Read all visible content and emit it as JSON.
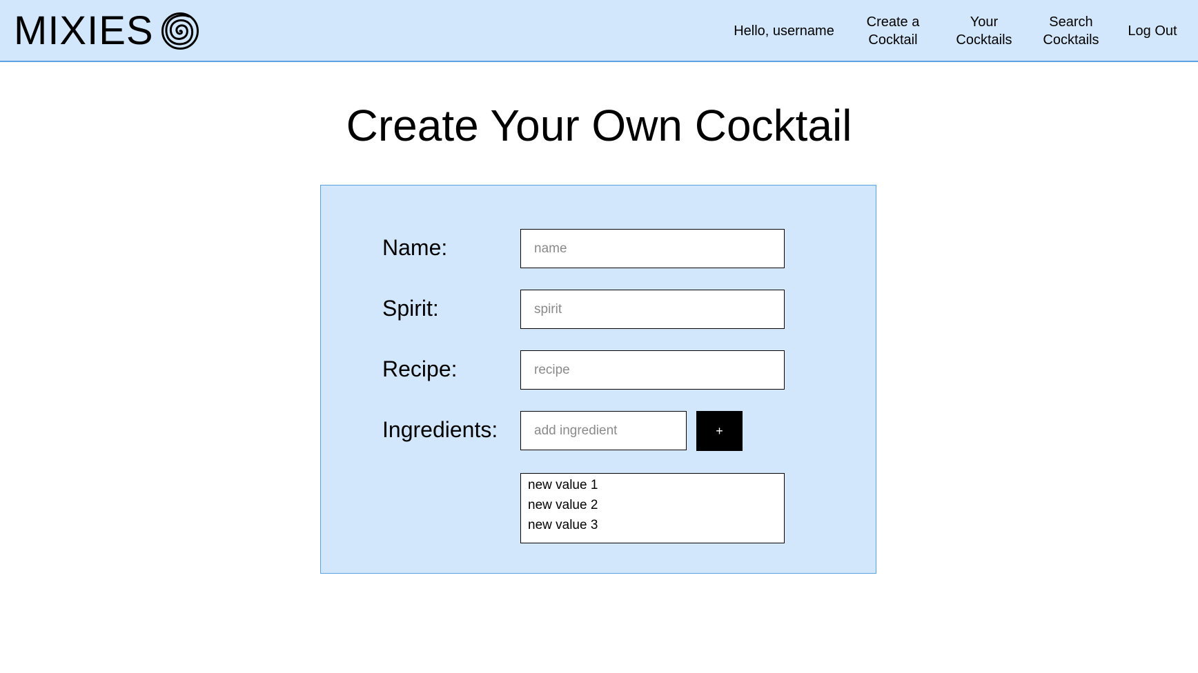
{
  "header": {
    "brand": "MIXIES",
    "greeting": "Hello, username",
    "nav": {
      "create": [
        "Create a",
        "Cocktail"
      ],
      "yours": [
        "Your",
        "Cocktails"
      ],
      "search": [
        "Search",
        "Cocktails"
      ],
      "logout": "Log Out"
    },
    "logo_icon": "spiral-icon"
  },
  "main": {
    "title": "Create Your Own Cocktail",
    "form": {
      "name": {
        "label": "Name:",
        "placeholder": "name",
        "value": ""
      },
      "spirit": {
        "label": "Spirit:",
        "placeholder": "spirit",
        "value": ""
      },
      "recipe": {
        "label": "Recipe:",
        "placeholder": "recipe",
        "value": ""
      },
      "ingredients": {
        "label": "Ingredients:",
        "placeholder": "add ingredient",
        "value": "",
        "add_button_label": "+",
        "items": [
          "new value 1",
          "new value 2",
          "new value 3"
        ]
      }
    }
  },
  "colors": {
    "header_bg": "#d2e7fb",
    "accent_border": "#5aa2df",
    "panel_bg": "#d2e7fb",
    "button_bg": "#000000",
    "button_text": "#ffffff"
  }
}
